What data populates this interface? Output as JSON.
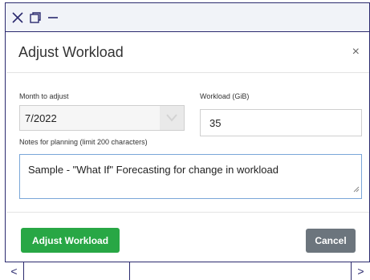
{
  "modal": {
    "title": "Adjust Workload",
    "close_label": "×"
  },
  "form": {
    "month_label": "Month to adjust",
    "month_value": "7/2022",
    "workload_label": "Workload (GiB)",
    "workload_value": "35",
    "notes_label": "Notes for planning (limit 200 characters)",
    "notes_value": "Sample - \"What If\" Forecasting for change in workload"
  },
  "footer": {
    "primary_label": "Adjust Workload",
    "secondary_label": "Cancel"
  },
  "scrollbar": {
    "left_label": "<",
    "right_label": ">"
  },
  "colors": {
    "primary": "#28a745",
    "secondary": "#6c757d",
    "frame": "#2b2a6e"
  }
}
